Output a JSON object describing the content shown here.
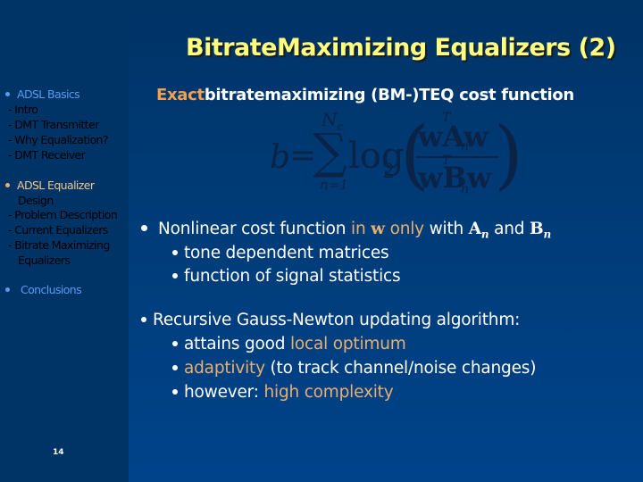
{
  "slide": {
    "title": "BitrateMaximizing Equalizers (2)",
    "page_number": "14",
    "colors": {
      "background": "#003366",
      "title": "#ffff80",
      "accent": "#e8b070",
      "nav_blue": "#5a9cf0",
      "body": "#ffffff"
    }
  },
  "sidebar": {
    "items": [
      {
        "label": "ADSL Basics",
        "type": "bullet",
        "state": "inactive"
      },
      {
        "label": "- Intro",
        "type": "sub",
        "state": "inactive"
      },
      {
        "label": "- DMT Transmitter",
        "type": "sub",
        "state": "inactive"
      },
      {
        "label": "- Why Equalization?",
        "type": "sub",
        "state": "inactive"
      },
      {
        "label": "- DMT Receiver",
        "type": "sub",
        "state": "inactive"
      },
      {
        "label": "ADSL Equalizer",
        "label2": "Design",
        "type": "bullet",
        "state": "active"
      },
      {
        "label": "- Problem Description",
        "type": "sub",
        "state": "inactive"
      },
      {
        "label": "- Current Equalizers",
        "type": "sub",
        "state": "inactive"
      },
      {
        "label": "- Bitrate Maximizing",
        "label2": "Equalizers",
        "type": "sub",
        "state": "active"
      },
      {
        "label": "Conclusions",
        "type": "bullet",
        "state": "inactive"
      }
    ]
  },
  "main": {
    "subheading": {
      "accent": "Exact",
      "rest": "bitratemaximizing (BM-)TEQ cost function"
    },
    "formula": {
      "lhs": "b",
      "eq": "=",
      "sum": "∑",
      "upper": "N",
      "upper_sub": "c",
      "lower": "n=1",
      "log": "log",
      "log_base": "2",
      "num": "wAw",
      "num_sup": "T",
      "num_sub": "n",
      "den": "wBw",
      "den_sup": "T",
      "den_sub": "n"
    },
    "bullet1": {
      "pre": "Nonlinear cost function ",
      "accent1": "in ",
      "accent_w": "w",
      "accent2": " only",
      "mid": " with ",
      "A": "A",
      "A_sub": "n",
      "and": " and ",
      "B": "B",
      "B_sub": "n",
      "subs": [
        "tone dependent matrices",
        "function of signal statistics"
      ]
    },
    "bullet2": {
      "text": "Recursive Gauss-Newton updating algorithm:",
      "sub1_pre": "attains good ",
      "sub1_accent": "local optimum",
      "sub2_accent": "adaptivity",
      "sub2_post": " (to track channel/noise changes)",
      "sub3_pre": "however: ",
      "sub3_accent": "high complexity"
    }
  }
}
